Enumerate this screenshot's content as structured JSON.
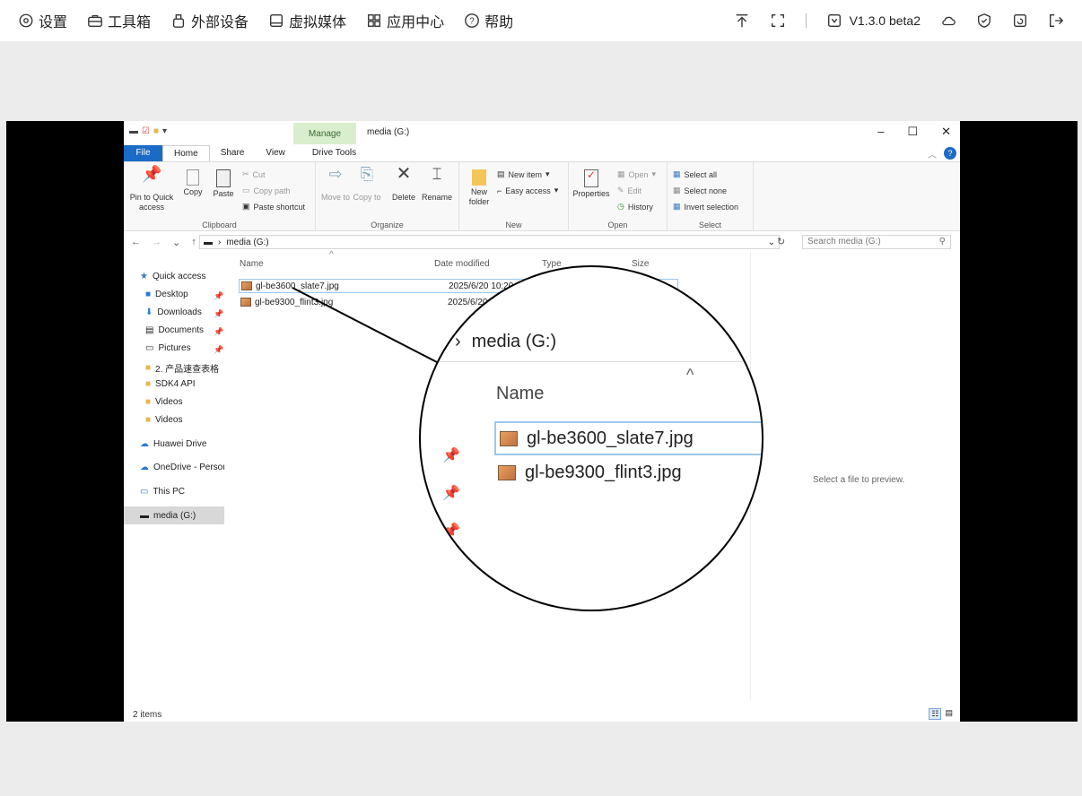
{
  "topbar": {
    "menu": [
      {
        "icon": "settings-icon",
        "label": "设置"
      },
      {
        "icon": "toolbox-icon",
        "label": "工具箱"
      },
      {
        "icon": "usb-device-icon",
        "label": "外部设备"
      },
      {
        "icon": "virtual-media-icon",
        "label": "虚拟媒体"
      },
      {
        "icon": "app-center-icon",
        "label": "应用中心"
      },
      {
        "icon": "help-icon",
        "label": "帮助"
      }
    ],
    "version": "V1.3.0 beta2"
  },
  "explorer": {
    "title": "media (G:)",
    "manage_tab": "Manage",
    "drive_tools_tab": "Drive Tools",
    "tabs": [
      "File",
      "Home",
      "Share",
      "View"
    ],
    "ribbon": {
      "clipboard": {
        "label": "Clipboard",
        "pin": "Pin to Quick access",
        "copy": "Copy",
        "paste": "Paste",
        "cut": "Cut",
        "copy_path": "Copy path",
        "paste_shortcut": "Paste shortcut"
      },
      "organize": {
        "label": "Organize",
        "move_to": "Move to",
        "copy_to": "Copy to",
        "delete": "Delete",
        "rename": "Rename"
      },
      "new": {
        "label": "New",
        "new_folder": "New folder",
        "new_item": "New item",
        "easy_access": "Easy access"
      },
      "open": {
        "label": "Open",
        "properties": "Properties",
        "open": "Open",
        "edit": "Edit",
        "history": "History"
      },
      "select": {
        "label": "Select",
        "select_all": "Select all",
        "select_none": "Select none",
        "invert": "Invert selection"
      }
    },
    "address": "media (G:)",
    "search_placeholder": "Search media (G:)",
    "nav": [
      {
        "label": "Quick access"
      },
      {
        "label": "Desktop"
      },
      {
        "label": "Downloads"
      },
      {
        "label": "Documents"
      },
      {
        "label": "Pictures"
      },
      {
        "label": "2. 产品速查表格"
      },
      {
        "label": "SDK4 API"
      },
      {
        "label": "Videos"
      },
      {
        "label": "Videos"
      },
      {
        "label": "Huawei Drive"
      },
      {
        "label": "OneDrive - Personal"
      },
      {
        "label": "This PC"
      },
      {
        "label": "media (G:)"
      }
    ],
    "columns": {
      "name": "Name",
      "date": "Date modified",
      "type": "Type",
      "size": "Size"
    },
    "files": [
      {
        "name": "gl-be3600_slate7.jpg",
        "date": "2025/6/20 10:20 AM"
      },
      {
        "name": "gl-be9300_flint3.jpg",
        "date": "2025/6/20 10"
      }
    ],
    "preview_text": "Select a file to preview.",
    "status": "2 items"
  },
  "magnifier": {
    "address": "media (G:)",
    "column_name": "Name",
    "files": [
      "gl-be3600_slate7.jpg",
      "gl-be9300_flint3.jpg"
    ]
  }
}
